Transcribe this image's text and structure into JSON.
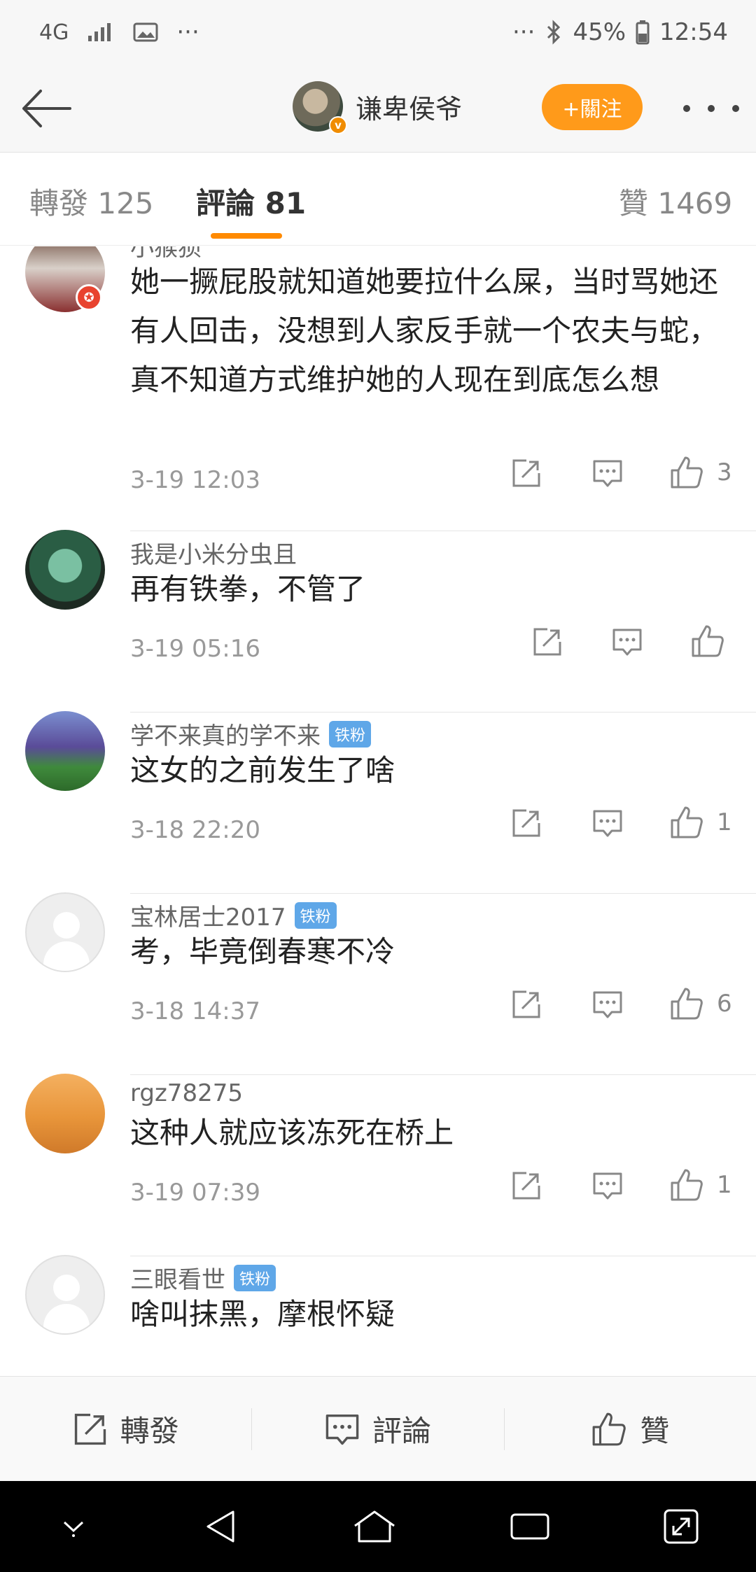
{
  "status_bar": {
    "network": "4G",
    "left_more": "···",
    "right_more": "···",
    "battery": "45%",
    "time": "12:54"
  },
  "header": {
    "username": "谦卑侯爷",
    "follow_label": "+關注"
  },
  "tabs": [
    {
      "label": "轉發 125"
    },
    {
      "label": "評論 81"
    },
    {
      "label": "贊 1469"
    }
  ],
  "comments": [
    {
      "name": "小猴狈",
      "text": "她一撅屁股就知道她要拉什么屎，当时骂她还有人回击，没想到人家反手就一个农夫与蛇，真不知道方式维护她的人现在到底怎么想",
      "time": "3-19 12:03",
      "likes": "3",
      "fan_badge": ""
    },
    {
      "name": "我是小米分虫且",
      "text": "再有铁拳，不管了",
      "time": "3-19 05:16",
      "likes": "",
      "fan_badge": ""
    },
    {
      "name": "学不来真的学不来",
      "text": "这女的之前发生了啥",
      "time": "3-18 22:20",
      "likes": "1",
      "fan_badge": "铁粉"
    },
    {
      "name": "宝林居士2017",
      "text": "考，毕竟倒春寒不冷",
      "time": "3-18 14:37",
      "likes": "6",
      "fan_badge": "铁粉"
    },
    {
      "name": "rgz78275",
      "text": "这种人就应该冻死在桥上",
      "time": "3-19 07:39",
      "likes": "1",
      "fan_badge": ""
    },
    {
      "name": "三眼看世",
      "text": "啥叫抹黑，摩根怀疑",
      "time": "",
      "likes": "",
      "fan_badge": "铁粉"
    }
  ],
  "bottom_bar": {
    "repost_label": "轉發",
    "comment_label": "評論",
    "like_label": "贊"
  }
}
